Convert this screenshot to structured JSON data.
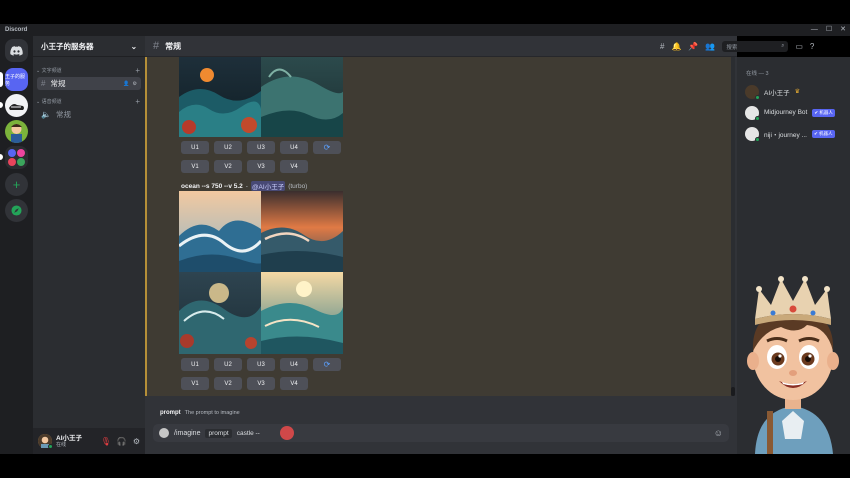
{
  "window": {
    "app_name": "Discord"
  },
  "servers": [
    {
      "name": "王子的服务"
    }
  ],
  "sidebar": {
    "guild_name": "小王子的服务器",
    "categories": [
      {
        "label": "文字频道",
        "channel": "常规"
      },
      {
        "label": "语音频道",
        "channel": "常规"
      }
    ]
  },
  "user": {
    "name": "AI小王子",
    "status": "在线"
  },
  "header": {
    "channel_name": "常规",
    "search_placeholder": "搜索"
  },
  "message": {
    "prompt_text": "ocean --s 750 --v 5.2",
    "separator": "-",
    "mention": "@AI小王子",
    "mode": "(turbo)"
  },
  "buttons": {
    "upscale": [
      "U1",
      "U2",
      "U3",
      "U4"
    ],
    "variation": [
      "V1",
      "V2",
      "V3",
      "V4"
    ]
  },
  "prompt_hint": {
    "name": "prompt",
    "description": "The prompt to imagine"
  },
  "composer": {
    "command": "/imagine",
    "option": "prompt",
    "value": "castle --"
  },
  "members": {
    "online_header": "在线 — 3",
    "list": [
      {
        "name": "AI小王子",
        "badge": ""
      },
      {
        "name": "Midjourney Bot",
        "badge": "✔ 机器人"
      },
      {
        "name": "niji・journey ...",
        "badge": "✔ 机器人"
      }
    ]
  },
  "colors": {
    "accent": "#5865f2",
    "online": "#23a559",
    "highlight_border": "#b58f38"
  }
}
